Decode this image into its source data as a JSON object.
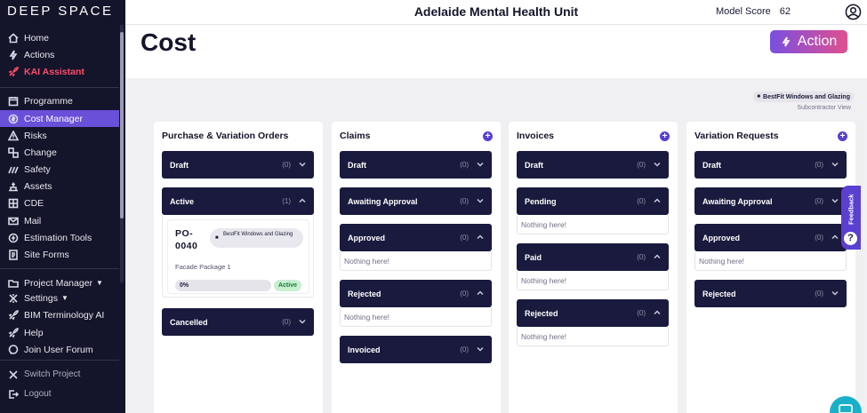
{
  "brand": "DEEP SPACE",
  "header": {
    "unit_title": "Adelaide Mental Health Unit",
    "model_score_label": "Model Score",
    "model_score_value": "62"
  },
  "page": {
    "title": "Cost",
    "action_label": "Action"
  },
  "sidebar": {
    "items": [
      {
        "label": "Home",
        "icon": "home-icon"
      },
      {
        "label": "Actions",
        "icon": "bolt-icon"
      },
      {
        "label": "KAI Assistant",
        "icon": "rocket-icon"
      },
      {
        "label": "Programme",
        "icon": "calendar-icon"
      },
      {
        "label": "Cost Manager",
        "icon": "cost-icon"
      },
      {
        "label": "Risks",
        "icon": "warning-icon"
      },
      {
        "label": "Change",
        "icon": "change-icon"
      },
      {
        "label": "Safety",
        "icon": "safety-icon"
      },
      {
        "label": "Assets",
        "icon": "assets-icon"
      },
      {
        "label": "CDE",
        "icon": "windows-icon"
      },
      {
        "label": "Mail",
        "icon": "mail-icon"
      },
      {
        "label": "Estimation Tools",
        "icon": "estimation-icon"
      },
      {
        "label": "Site Forms",
        "icon": "forms-icon"
      },
      {
        "label": "Project Manager",
        "icon": "folder-icon"
      },
      {
        "label": "Settings",
        "icon": "gear-icon"
      },
      {
        "label": "BIM Terminology AI",
        "icon": "rocket-icon"
      },
      {
        "label": "Help",
        "icon": "rocket-icon"
      },
      {
        "label": "Join User Forum",
        "icon": "chat-icon"
      },
      {
        "label": "Switch Project",
        "icon": "switch-icon"
      },
      {
        "label": "Logout",
        "icon": "logout-icon"
      }
    ]
  },
  "subcontractor": {
    "name": "BestFit Windows and Glazing",
    "view_label": "Subcontractor View"
  },
  "columns": {
    "po": {
      "title": "Purchase & Variation Orders",
      "groups": [
        {
          "label": "Draft",
          "count": "(0)"
        },
        {
          "label": "Active",
          "count": "(1)"
        },
        {
          "label": "Cancelled",
          "count": "(0)"
        }
      ],
      "card": {
        "ref": "PO-0040",
        "supplier": "BestFit Windows and Glazing",
        "package": "Facade Package 1",
        "progress": "0%",
        "status": "Active"
      }
    },
    "claims": {
      "title": "Claims",
      "groups": [
        {
          "label": "Draft",
          "count": "(0)"
        },
        {
          "label": "Awaiting Approval",
          "count": "(0)"
        },
        {
          "label": "Approved",
          "count": "(0)"
        },
        {
          "label": "Rejected",
          "count": "(0)"
        },
        {
          "label": "Invoiced",
          "count": "(0)"
        }
      ]
    },
    "invoices": {
      "title": "Invoices",
      "groups": [
        {
          "label": "Draft",
          "count": "(0)"
        },
        {
          "label": "Pending",
          "count": "(0)"
        },
        {
          "label": "Paid",
          "count": "(0)"
        },
        {
          "label": "Rejected",
          "count": "(0)"
        }
      ]
    },
    "variations": {
      "title": "Variation Requests",
      "groups": [
        {
          "label": "Draft",
          "count": "(0)"
        },
        {
          "label": "Awaiting Approval",
          "count": "(0)"
        },
        {
          "label": "Approved",
          "count": "(0)"
        },
        {
          "label": "Rejected",
          "count": "(0)"
        }
      ]
    }
  },
  "empty_text": "Nothing here!",
  "feedback_label": "Feedback",
  "help_symbol": "?",
  "colors": {
    "sidebar_bg": "#14142a",
    "accent": "#6a4fd8",
    "group_bg": "#1a1a3e",
    "kai_red": "#ff4d6a",
    "status_green": "#c8f0d0"
  }
}
